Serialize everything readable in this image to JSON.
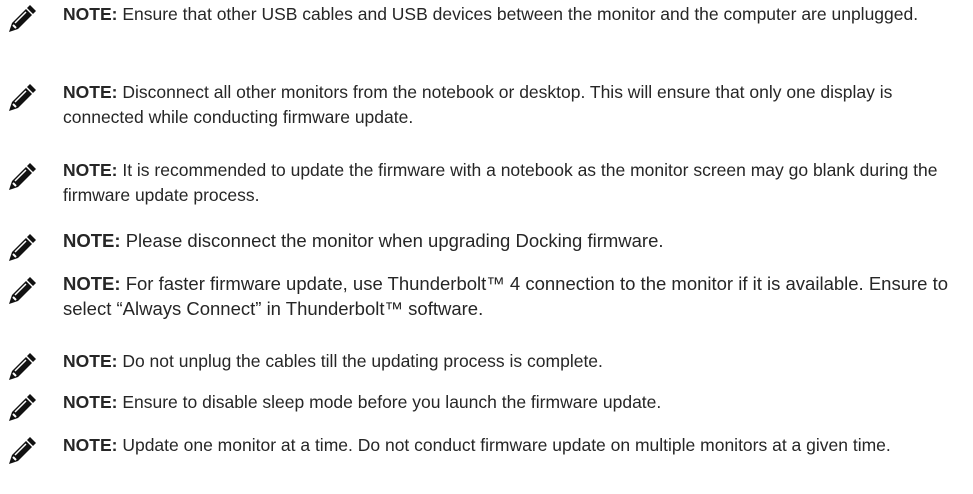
{
  "label": "NOTE:",
  "notes": [
    {
      "text": "Ensure that other USB cables and USB devices between the monitor and the computer are unplugged."
    },
    {
      "text": "Disconnect all other monitors from the notebook or desktop. This will ensure that only one display is connected while conducting firmware update."
    },
    {
      "text": "It is recommended to update the firmware with a notebook as the monitor screen may go blank during the firmware update process."
    },
    {
      "text": "Please disconnect the monitor when upgrading Docking firmware."
    },
    {
      "text": "For faster firmware update, use Thunderbolt™ 4 connection to the monitor if it is available. Ensure to select “Always Connect” in Thunderbolt™ software."
    },
    {
      "text": "Do not unplug the cables till the updating process is complete."
    },
    {
      "text": "Ensure to disable sleep mode before you launch the firmware update."
    },
    {
      "text": "Update one monitor at a time. Do not conduct firmware update on multiple monitors at a given time."
    }
  ]
}
